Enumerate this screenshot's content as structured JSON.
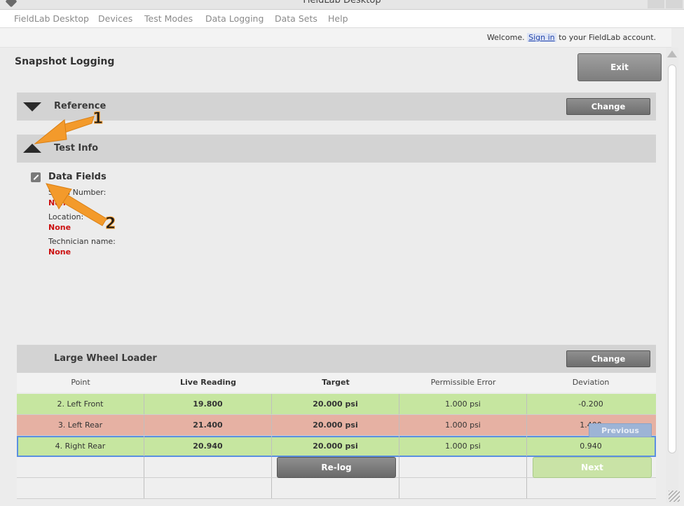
{
  "window": {
    "title": "FieldLab Desktop"
  },
  "menu": [
    "FieldLab Desktop",
    "Devices",
    "Test Modes",
    "Data Logging",
    "Data Sets",
    "Help"
  ],
  "welcome": {
    "prefix": "Welcome.",
    "link": "Sign in",
    "suffix": "to your FieldLab account."
  },
  "page": {
    "title": "Snapshot Logging",
    "exit_label": "Exit"
  },
  "reference": {
    "label": "Reference",
    "change_label": "Change"
  },
  "test_info": {
    "label": "Test Info",
    "fields_title": "Data Fields",
    "fields": [
      {
        "label": "Serial Number:",
        "value": "None"
      },
      {
        "label": "Location:",
        "value": "None"
      },
      {
        "label": "Technician name:",
        "value": "None"
      }
    ]
  },
  "machine": {
    "label": "Large Wheel Loader",
    "change_label": "Change"
  },
  "table": {
    "headers": [
      "Point",
      "Live Reading",
      "Target",
      "Permissible Error",
      "Deviation"
    ],
    "rows": [
      {
        "point": "2. Left Front",
        "live": "19.800",
        "target": "20.000 psi",
        "error": "1.000 psi",
        "deviation": "-0.200",
        "status": "green"
      },
      {
        "point": "3. Left Rear",
        "live": "21.400",
        "target": "20.000 psi",
        "error": "1.000 psi",
        "deviation": "1.400",
        "status": "red"
      },
      {
        "point": "4. Right Rear",
        "live": "20.940",
        "target": "20.000 psi",
        "error": "1.000 psi",
        "deviation": "0.940",
        "status": "green"
      }
    ]
  },
  "actions": {
    "relog_label": "Re-log",
    "next_label": "Next",
    "previous_label": "Previous"
  },
  "callouts": [
    "1",
    "2"
  ],
  "colors": {
    "callout": "#f39a2b",
    "ok_row": "#c6e6a0",
    "fail_row": "#e6b1a3",
    "none_value": "#cc1111"
  }
}
